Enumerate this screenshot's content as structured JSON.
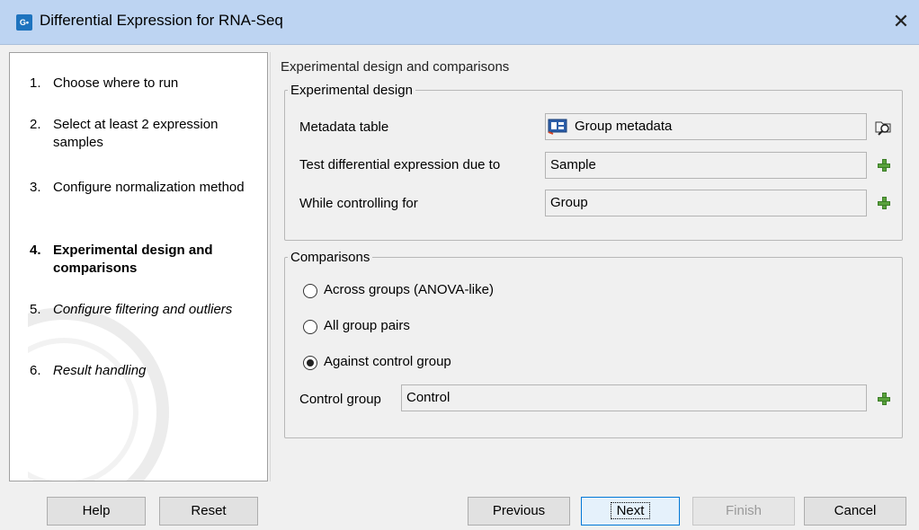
{
  "window": {
    "title": "Differential Expression for RNA-Seq",
    "close_glyph": "✕"
  },
  "steps": [
    {
      "num": "1.",
      "label": "Choose where to run"
    },
    {
      "num": "2.",
      "label": "Select at least 2 expression samples"
    },
    {
      "num": "3.",
      "label": "Configure normalization method"
    },
    {
      "num": "4.",
      "label": "Experimental design and comparisons"
    },
    {
      "num": "5.",
      "label": "Configure filtering and outliers"
    },
    {
      "num": "6.",
      "label": "Result handling"
    }
  ],
  "content": {
    "title": "Experimental design and comparisons",
    "experimental_design": {
      "legend": "Experimental design",
      "metadata_label": "Metadata table",
      "metadata_value": "Group metadata",
      "test_label": "Test differential expression due to",
      "test_value": "Sample",
      "control_label": "While controlling for",
      "control_value": "Group"
    },
    "comparisons": {
      "legend": "Comparisons",
      "options": [
        "Across groups (ANOVA-like)",
        "All group pairs",
        "Against control group"
      ],
      "selected_option": "Against control group",
      "control_group_label": "Control group",
      "control_group_value": "Control"
    }
  },
  "buttons": {
    "help": "Help",
    "reset": "Reset",
    "previous": "Previous",
    "next": "Next",
    "finish": "Finish",
    "cancel": "Cancel"
  },
  "colors": {
    "titlebar": "#bdd4f2",
    "add_icon": "#5aa33c",
    "focus_border": "#0078d7"
  }
}
